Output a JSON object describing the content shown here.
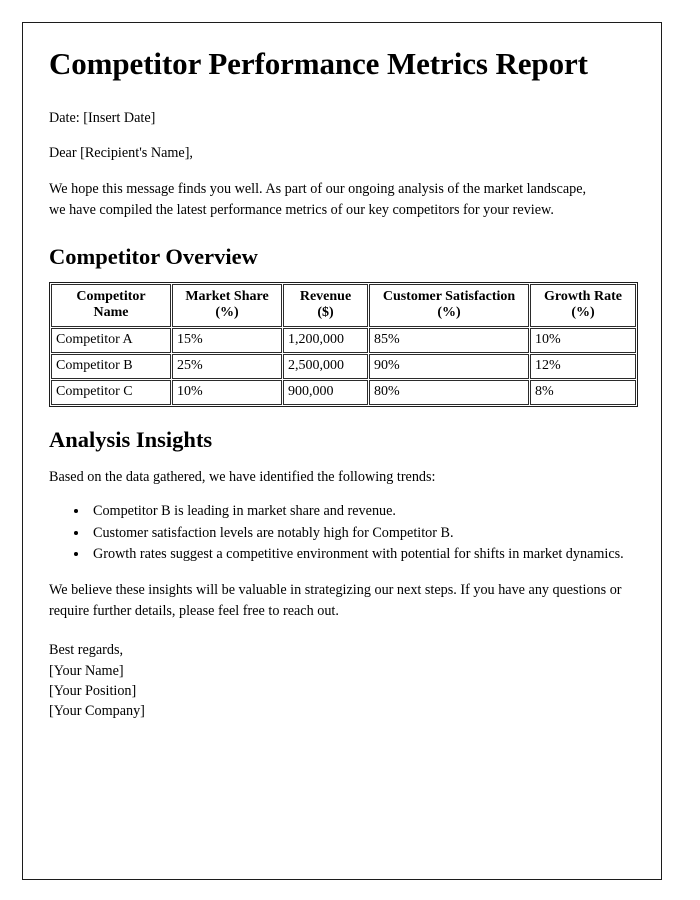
{
  "document": {
    "title": "Competitor Performance Metrics Report",
    "date_line": "Date: [Insert Date]",
    "salutation": "Dear [Recipient's Name],",
    "intro_paragraph": "We hope this message finds you well. As part of our ongoing analysis of the market landscape, we have compiled the latest performance metrics of our key competitors for your review.",
    "overview_heading": "Competitor Overview",
    "insights_heading": "Analysis Insights",
    "insights_intro": "Based on the data gathered, we have identified the following trends:",
    "closing_paragraph": "We believe these insights will be valuable in strategizing our next steps. If you have any questions or require further details, please feel free to reach out.",
    "signature": {
      "closing": "Best regards,",
      "name": "[Your Name]",
      "position": "[Your Position]",
      "company": "[Your Company]"
    }
  },
  "table": {
    "headers": [
      "Competitor Name",
      "Market Share (%)",
      "Revenue ($)",
      "Customer Satisfaction (%)",
      "Growth Rate (%)"
    ],
    "headers_split": [
      {
        "l1": "Competitor",
        "l2": "Name"
      },
      {
        "l1": "Market Share",
        "l2": "(%)"
      },
      {
        "l1": "Revenue",
        "l2": "($)"
      },
      {
        "l1": "Customer Satisfaction",
        "l2": "(%)"
      },
      {
        "l1": "Growth Rate",
        "l2": "(%)"
      }
    ],
    "rows": [
      {
        "name": "Competitor A",
        "market_share": "15%",
        "revenue": "1,200,000",
        "satisfaction": "85%",
        "growth": "10%"
      },
      {
        "name": "Competitor B",
        "market_share": "25%",
        "revenue": "2,500,000",
        "satisfaction": "90%",
        "growth": "12%"
      },
      {
        "name": "Competitor C",
        "market_share": "10%",
        "revenue": "900,000",
        "satisfaction": "80%",
        "growth": "8%"
      }
    ]
  },
  "insights": {
    "bullets": [
      "Competitor B is leading in market share and revenue.",
      "Customer satisfaction levels are notably high for Competitor B.",
      "Growth rates suggest a competitive environment with potential for shifts in market dynamics."
    ]
  }
}
